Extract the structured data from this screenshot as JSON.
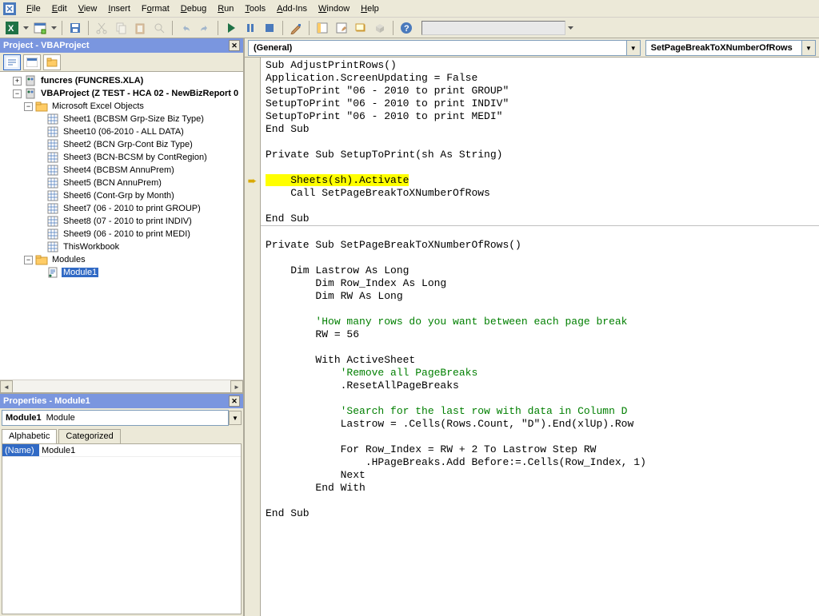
{
  "menu": {
    "items": [
      "File",
      "Edit",
      "View",
      "Insert",
      "Format",
      "Debug",
      "Run",
      "Tools",
      "Add-Ins",
      "Window",
      "Help"
    ]
  },
  "project_panel": {
    "title": "Project - VBAProject",
    "tree": {
      "funcres": "funcres (FUNCRES.XLA)",
      "vbaproject": "VBAProject (Z TEST - HCA 02 - NewBizReport 0",
      "excel_objects_folder": "Microsoft Excel Objects",
      "sheets": [
        "Sheet1 (BCBSM Grp-Size Biz Type)",
        "Sheet10 (06-2010 - ALL DATA)",
        "Sheet2 (BCN Grp-Cont Biz Type)",
        "Sheet3 (BCN-BCSM by ContRegion)",
        "Sheet4 (BCBSM AnnuPrem)",
        "Sheet5 (BCN AnnuPrem)",
        "Sheet6 (Cont-Grp by Month)",
        "Sheet7 (06 - 2010 to print GROUP)",
        "Sheet8 (07 - 2010 to print INDIV)",
        "Sheet9 (06 - 2010 to print MEDI)",
        "ThisWorkbook"
      ],
      "modules_folder": "Modules",
      "module1": "Module1"
    }
  },
  "properties_panel": {
    "title": "Properties - Module1",
    "combo_bold": "Module1",
    "combo_rest": "Module",
    "tab_alpha": "Alphabetic",
    "tab_cat": "Categorized",
    "rows": [
      {
        "name": "(Name)",
        "value": "Module1"
      }
    ]
  },
  "code_combos": {
    "left": "(General)",
    "right": "SetPageBreakToXNumberOfRows"
  },
  "code": {
    "sub1": [
      "Sub AdjustPrintRows()",
      "Application.ScreenUpdating = False",
      "SetupToPrint \"06 - 2010 to print GROUP\"",
      "SetupToPrint \"06 - 2010 to print INDIV\"",
      "SetupToPrint \"06 - 2010 to print MEDI\"",
      "End Sub"
    ],
    "sub2_hdr": "Private Sub SetupToPrint(sh As String)",
    "sub2_hl": "    Sheets(sh).Activate",
    "sub2_call": "    Call SetPageBreakToXNumberOfRows",
    "sub2_end": "End Sub",
    "sub3_hdr": "Private Sub SetPageBreakToXNumberOfRows()",
    "dim1": "    Dim Lastrow As Long",
    "dim2": "        Dim Row_Index As Long",
    "dim3": "        Dim RW As Long",
    "cmt1": "        'How many rows do you want between each page break",
    "rw": "        RW = 56",
    "with": "        With ActiveSheet",
    "cmt2": "            'Remove all PageBreaks",
    "reset": "            .ResetAllPageBreaks",
    "cmt3": "            'Search for the last row with data in Column D",
    "lastrow": "            Lastrow = .Cells(Rows.Count, \"D\").End(xlUp).Row",
    "for": "            For Row_Index = RW + 2 To Lastrow Step RW",
    "hpb": "                .HPageBreaks.Add Before:=.Cells(Row_Index, 1)",
    "next": "            Next",
    "endwith": "        End With",
    "endsub": "End Sub"
  }
}
